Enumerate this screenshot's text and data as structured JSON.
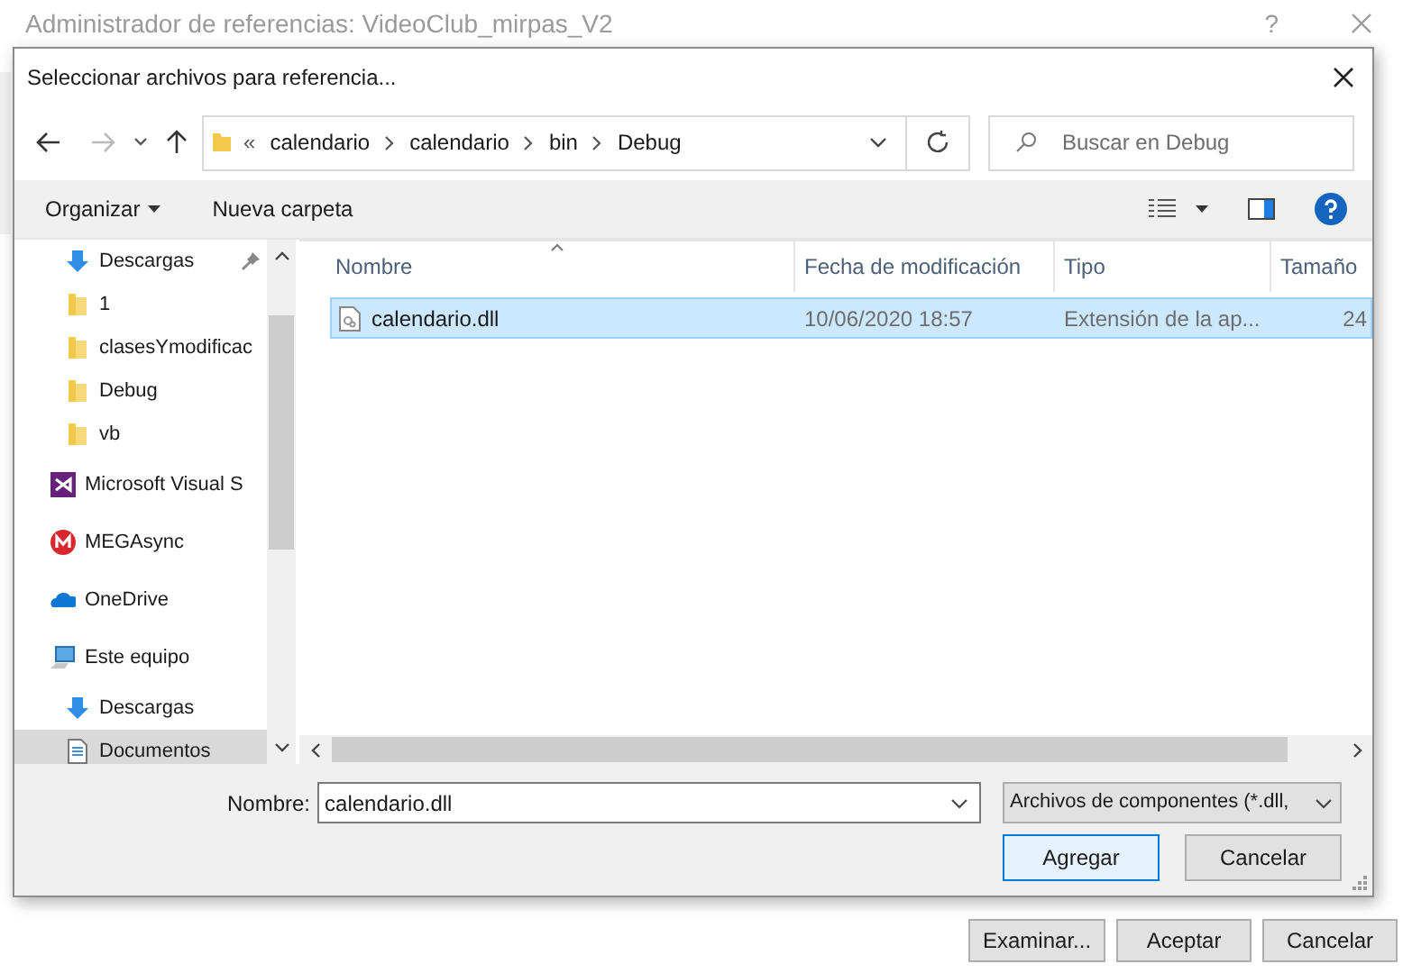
{
  "window": {
    "title": "Administrador de referencias: VideoClub_mirpas_V2",
    "help": "?",
    "buttons": [
      {
        "label": "Examinar..."
      },
      {
        "label": "Aceptar"
      },
      {
        "label": "Cancelar"
      }
    ]
  },
  "dialog": {
    "title": "Seleccionar archivos para referencia...",
    "address": {
      "overflow": "«",
      "crumbs": [
        "calendario",
        "calendario",
        "bin",
        "Debug"
      ]
    },
    "search": {
      "placeholder": "Buscar en Debug"
    },
    "toolbar": {
      "organize": "Organizar",
      "new_folder": "Nueva carpeta"
    },
    "nav": [
      {
        "label": "Descargas",
        "kind": "download",
        "pinned": true,
        "selected": false
      },
      {
        "label": "1",
        "kind": "folder",
        "pinned": false,
        "selected": false
      },
      {
        "label": "clasesYmodificac",
        "kind": "folder",
        "pinned": false,
        "selected": false
      },
      {
        "label": "Debug",
        "kind": "folder",
        "pinned": false,
        "selected": false
      },
      {
        "label": "vb",
        "kind": "folder",
        "pinned": false,
        "selected": false
      },
      {
        "label": "Microsoft Visual S",
        "kind": "vs",
        "pinned": false,
        "selected": false
      },
      {
        "label": "MEGAsync",
        "kind": "mega",
        "pinned": false,
        "selected": false
      },
      {
        "label": "OneDrive",
        "kind": "onedrive",
        "pinned": false,
        "selected": false
      },
      {
        "label": "Este equipo",
        "kind": "pc",
        "pinned": false,
        "selected": false,
        "children": [
          {
            "label": "Descargas",
            "kind": "download",
            "pinned": false,
            "selected": false
          },
          {
            "label": "Documentos",
            "kind": "documents",
            "pinned": false,
            "selected": true
          }
        ]
      }
    ],
    "columns": [
      "Nombre",
      "Fecha de modificación",
      "Tipo",
      "Tamaño"
    ],
    "files": [
      {
        "name": "calendario.dll",
        "modified": "10/06/2020 18:57",
        "type": "Extensión de la ap...",
        "size": "24",
        "selected": true
      }
    ],
    "filename": {
      "label": "Nombre:",
      "value": "calendario.dll"
    },
    "filter": "Archivos de componentes (*.dll,",
    "buttons": [
      {
        "label": "Agregar",
        "default": true
      },
      {
        "label": "Cancelar",
        "default": false
      }
    ]
  }
}
